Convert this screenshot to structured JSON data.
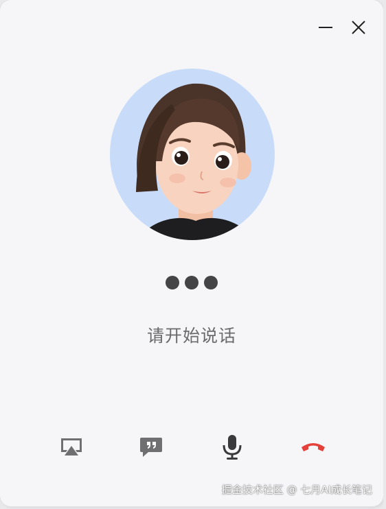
{
  "window": {
    "controls": {
      "minimize_icon": "minimize-icon",
      "close_icon": "close-icon"
    }
  },
  "avatar": {
    "background_color": "#c8dcfa"
  },
  "status": {
    "dots_count": 3,
    "prompt_text": "请开始说话"
  },
  "toolbar": {
    "buttons": [
      {
        "icon": "screen-cast-icon",
        "color": "#6f6f72"
      },
      {
        "icon": "chat-bubble-quote-icon",
        "color": "#6f6f72"
      },
      {
        "icon": "microphone-icon",
        "color": "#3a3a3d"
      },
      {
        "icon": "hang-up-phone-icon",
        "color": "#e5413b"
      }
    ]
  },
  "watermark": {
    "text": "掘金技术社区 @ 七月AI成长笔记"
  }
}
